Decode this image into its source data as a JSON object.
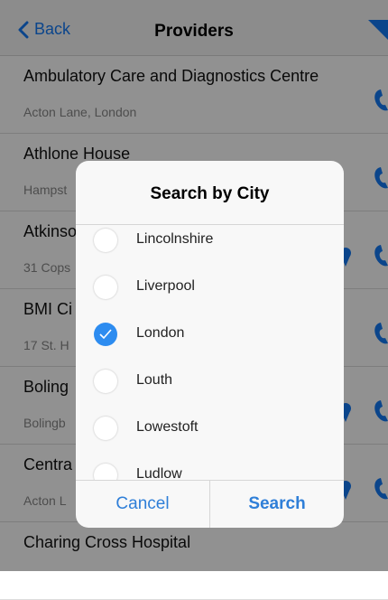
{
  "nav": {
    "back_label": "Back",
    "title": "Providers"
  },
  "providers": [
    {
      "name": "Ambulatory Care and Diagnostics Centre",
      "address": "Acton Lane, London",
      "has_map": false
    },
    {
      "name": "Athlone House",
      "address": "Hampst",
      "has_map": false
    },
    {
      "name": "Atkinso",
      "address": "31 Cops",
      "has_map": true
    },
    {
      "name": "BMI Ci",
      "address": "17 St. H",
      "has_map": false
    },
    {
      "name": "Boling",
      "address": "Bolingb",
      "has_map": true
    },
    {
      "name": "Centra",
      "address": "Acton L",
      "has_map": true
    },
    {
      "name": "Charing Cross Hospital",
      "address": "",
      "has_map": false
    }
  ],
  "modal": {
    "title": "Search by City",
    "options": [
      {
        "label": "Lincolnshire",
        "selected": false
      },
      {
        "label": "Liverpool",
        "selected": false
      },
      {
        "label": "London",
        "selected": true
      },
      {
        "label": "Louth",
        "selected": false
      },
      {
        "label": "Lowestoft",
        "selected": false
      },
      {
        "label": "Ludlow",
        "selected": false
      }
    ],
    "cancel_label": "Cancel",
    "search_label": "Search"
  },
  "colors": {
    "accent": "#1479f5",
    "overlay": "rgba(0,0,0,0.43)",
    "selected_radio": "#2d8cf0"
  }
}
